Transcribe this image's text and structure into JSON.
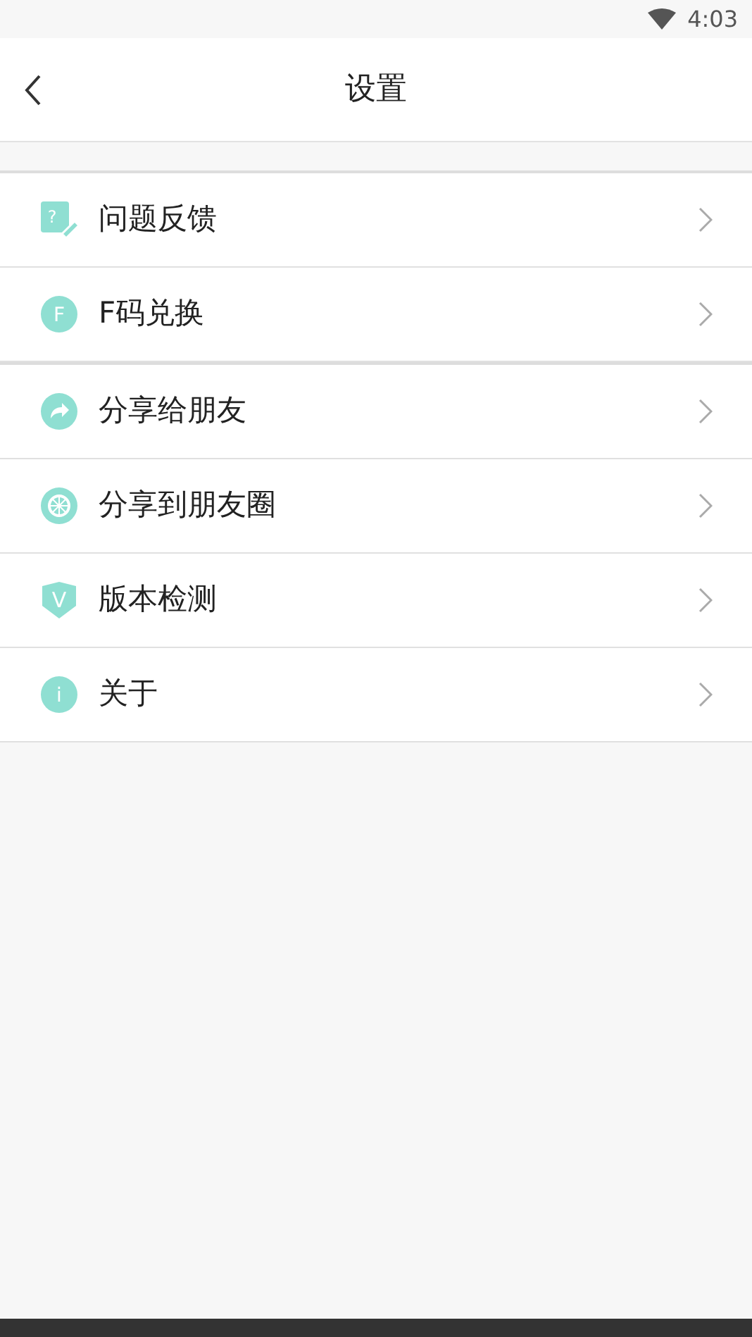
{
  "status_bar": {
    "time": "4:03"
  },
  "header": {
    "title": "设置"
  },
  "groups": [
    {
      "items": [
        {
          "label": "问题反馈",
          "kind": "feedback",
          "glyph": "?"
        },
        {
          "label": "F码兑换",
          "kind": "circle",
          "glyph": "F"
        }
      ]
    },
    {
      "items": [
        {
          "label": "分享给朋友",
          "kind": "share"
        },
        {
          "label": "分享到朋友圈",
          "kind": "moments"
        },
        {
          "label": "版本检测",
          "kind": "shield",
          "glyph": "V"
        },
        {
          "label": "关于",
          "kind": "circle",
          "glyph": "i"
        }
      ]
    }
  ]
}
